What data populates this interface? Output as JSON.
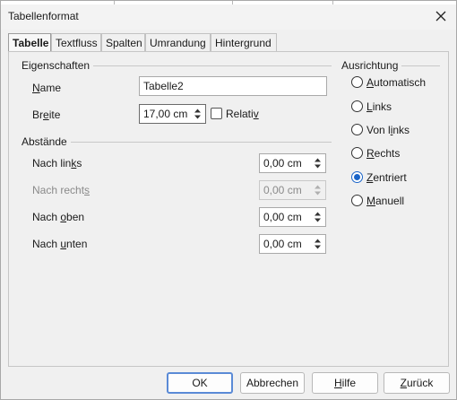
{
  "window": {
    "title": "Tabellenformat"
  },
  "tabs": [
    {
      "label": "Tabelle",
      "active": true
    },
    {
      "label": "Textfluss"
    },
    {
      "label": "Spalten"
    },
    {
      "label": "Umrandung"
    },
    {
      "label": "Hintergrund"
    }
  ],
  "properties": {
    "title": "Eigenschaften",
    "name": {
      "label_pre": "",
      "label_u": "N",
      "label_post": "ame",
      "value": "Tabelle2"
    },
    "width": {
      "label_pre": "Br",
      "label_u": "e",
      "label_post": "ite",
      "value": "17,00 cm"
    },
    "relative": {
      "label_pre": "Relati",
      "label_u": "v",
      "label_post": "",
      "checked": false
    }
  },
  "spacing": {
    "title": "Abstände",
    "left": {
      "label_pre": "Nach lin",
      "label_u": "k",
      "label_post": "s",
      "value": "0,00 cm",
      "disabled": false
    },
    "right": {
      "label_pre": "Nach recht",
      "label_u": "s",
      "label_post": "",
      "value": "0,00 cm",
      "disabled": true
    },
    "top": {
      "label_pre": "Nach ",
      "label_u": "o",
      "label_post": "ben",
      "value": "0,00 cm",
      "disabled": false
    },
    "bottom": {
      "label_pre": "Nach ",
      "label_u": "u",
      "label_post": "nten",
      "value": "0,00 cm",
      "disabled": false
    }
  },
  "alignment": {
    "title": "Ausrichtung",
    "options": [
      {
        "pre": "",
        "u": "A",
        "post": "utomatisch",
        "checked": false
      },
      {
        "pre": "",
        "u": "L",
        "post": "inks",
        "checked": false
      },
      {
        "pre": "Von l",
        "u": "i",
        "post": "nks",
        "checked": false
      },
      {
        "pre": "",
        "u": "R",
        "post": "echts",
        "checked": false
      },
      {
        "pre": "",
        "u": "Z",
        "post": "entriert",
        "checked": true
      },
      {
        "pre": "",
        "u": "M",
        "post": "anuell",
        "checked": false
      }
    ]
  },
  "buttons": {
    "ok": {
      "pre": "OK",
      "u": "",
      "post": ""
    },
    "cancel": {
      "pre": "Abbrechen",
      "u": "",
      "post": ""
    },
    "help": {
      "pre": "",
      "u": "H",
      "post": "ilfe"
    },
    "reset": {
      "pre": "",
      "u": "Z",
      "post": "urück"
    }
  },
  "colors": {
    "accent": "#1a64c8",
    "default_button_border": "#5a8ad6",
    "dialog_bg": "#f0f0f0"
  },
  "icons": {
    "close": "close-icon",
    "spin": "spin-arrows-icon"
  }
}
